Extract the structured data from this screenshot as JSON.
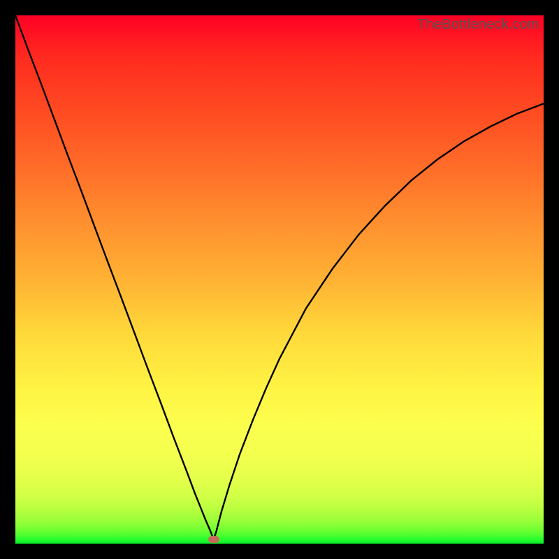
{
  "watermark": "TheBottleneck.com",
  "bump_color": "#c56a5c",
  "curve_color": "#000000",
  "chart_data": {
    "type": "line",
    "title": "",
    "xlabel": "",
    "ylabel": "",
    "xlim": [
      0,
      100
    ],
    "ylim": [
      0,
      100
    ],
    "min_marker": {
      "x": 37.5,
      "y": 0.8
    },
    "series": [
      {
        "name": "curve",
        "x": [
          0,
          2.5,
          5,
          7.5,
          10,
          12.5,
          15,
          17.5,
          20,
          22.5,
          25,
          27.5,
          30,
          32.5,
          34,
          35,
          36,
          37,
          37.5,
          38,
          39,
          40.5,
          42.5,
          45,
          47.5,
          50,
          55,
          60,
          65,
          70,
          75,
          80,
          85,
          90,
          95,
          100
        ],
        "y": [
          100,
          93.3,
          86.7,
          80,
          73.3,
          66.7,
          60,
          53.3,
          46.7,
          40,
          33.3,
          26.7,
          20,
          13.5,
          9.5,
          7,
          4.5,
          2.2,
          0.8,
          2.2,
          6,
          11,
          17,
          23.5,
          29.5,
          35,
          44.5,
          52,
          58.5,
          64,
          68.8,
          72.8,
          76.2,
          79,
          81.4,
          83.3
        ]
      }
    ]
  }
}
